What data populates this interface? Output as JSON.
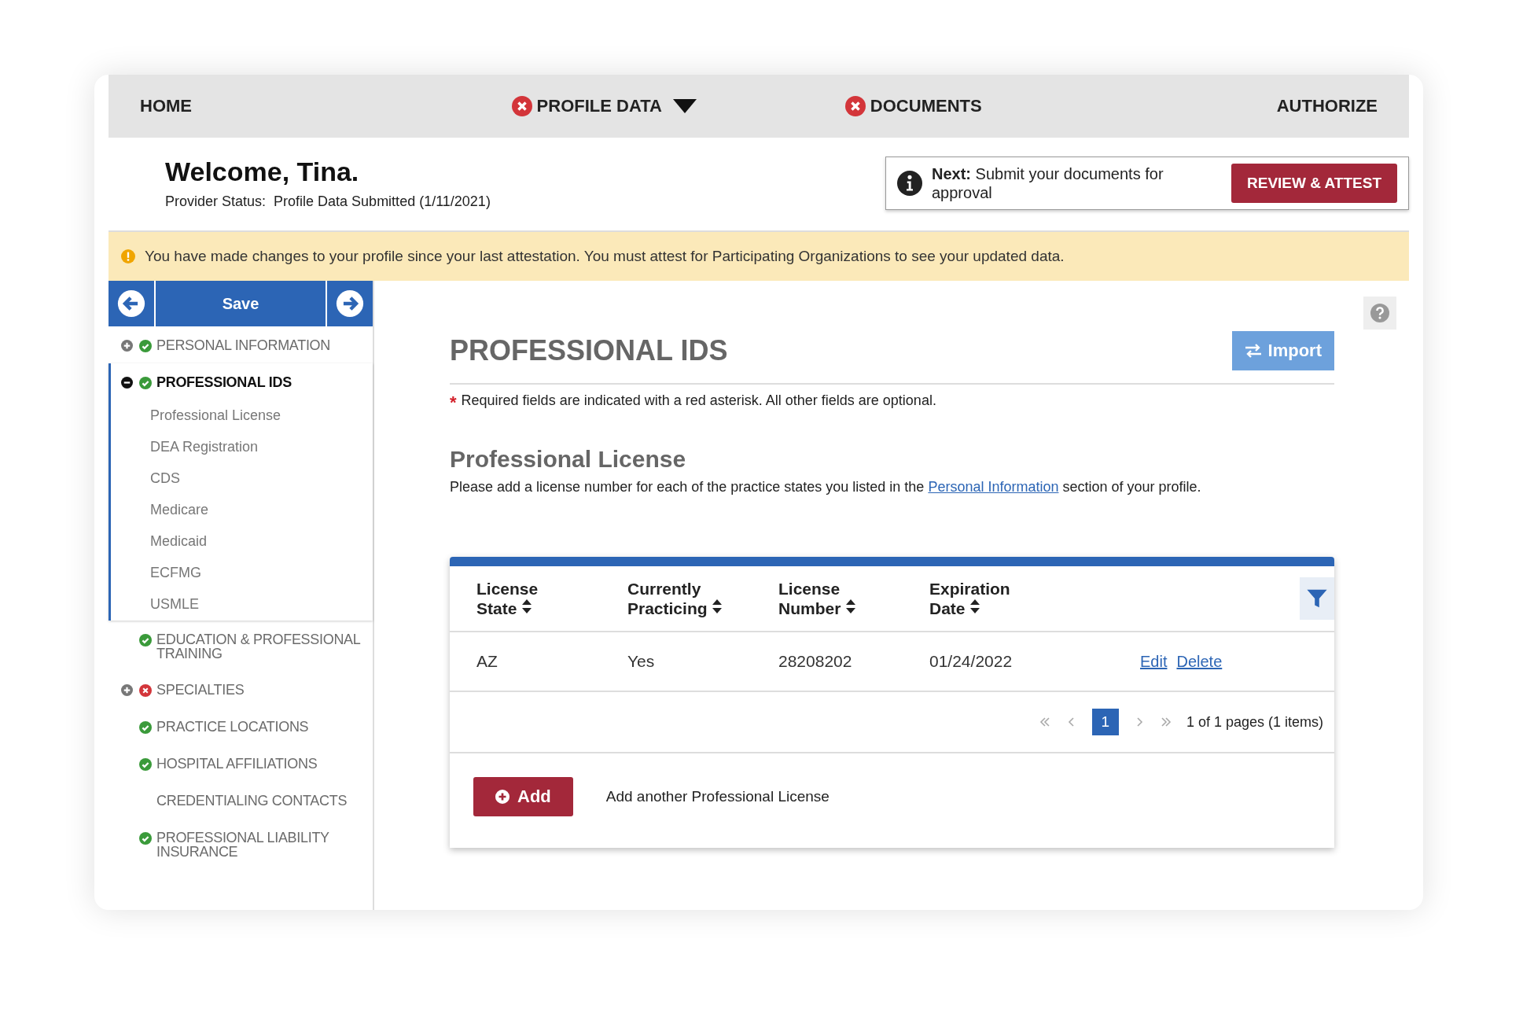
{
  "nav": [
    {
      "label": "HOME",
      "error": false,
      "dropdown": false
    },
    {
      "label": "PROFILE DATA",
      "error": true,
      "dropdown": true
    },
    {
      "label": "DOCUMENTS",
      "error": true,
      "dropdown": false
    },
    {
      "label": "AUTHORIZE",
      "error": false,
      "dropdown": false
    }
  ],
  "welcome": {
    "title": "Welcome, Tina.",
    "status": "Provider Status:  Profile Data Submitted (1/11/2021)"
  },
  "next_step": {
    "text": "**Next:** Submit your documents for approval",
    "button": "REVIEW & ATTEST"
  },
  "banner": {
    "text": "You have made changes to your profile since your last attestation. You must attest for Participating Organizations to see your updated data."
  },
  "sidebar": {
    "save": "Save",
    "items": [
      {
        "label": "PERSONAL INFORMATION",
        "expanded": false,
        "complete": true,
        "selected": false
      },
      {
        "label": "PROFESSIONAL IDS",
        "expanded": true,
        "complete": true,
        "selected": true,
        "children": [
          {
            "label": "Professional License"
          },
          {
            "label": "DEA Registration"
          },
          {
            "label": "CDS"
          },
          {
            "label": "Medicare"
          },
          {
            "label": "Medicaid"
          },
          {
            "label": "ECFMG"
          },
          {
            "label": "USMLE"
          }
        ]
      },
      {
        "label": "EDUCATION & PROFESSIONAL TRAINING",
        "complete": true,
        "selected": false
      },
      {
        "label": "SPECIALTIES",
        "expanded": false,
        "complete": false,
        "selected": false
      },
      {
        "label": "PRACTICE LOCATIONS",
        "complete": true,
        "selected": false
      },
      {
        "label": "HOSPITAL AFFILIATIONS",
        "complete": true,
        "selected": false
      },
      {
        "label": "CREDENTIALING CONTACTS",
        "selected": false
      },
      {
        "label": "PROFESSIONAL LIABILITY INSURANCE",
        "complete": true,
        "selected": false
      }
    ]
  },
  "main": {
    "title": "PROFESSIONAL IDS",
    "import_button": "Import",
    "required_mark": "*",
    "required_note": "Required fields are indicated with a red asterisk. All other fields are optional.",
    "section_title": "Professional License",
    "section_note_before": "Please add a license number for each of the practice states you listed in the",
    "section_link": "Personal Information",
    "section_note_after": "section of your profile.",
    "table": {
      "columns": [
        {
          "line1": "License",
          "line2": "State"
        },
        {
          "line1": "Currently",
          "line2": "Practicing"
        },
        {
          "line1": "License",
          "line2": "Number"
        },
        {
          "line1": "Expiration",
          "line2": "Date"
        }
      ],
      "rows": [
        {
          "cells": [
            "AZ",
            "Yes",
            "28208202",
            "01/24/2022"
          ],
          "actions": [
            "Edit",
            "Delete"
          ]
        }
      ],
      "pages": [
        {
          "label": "1",
          "selected": true
        }
      ],
      "page_info": "1 of 1 pages (1 items)"
    },
    "add_button": "Add",
    "add_note": "Add another Professional License"
  }
}
